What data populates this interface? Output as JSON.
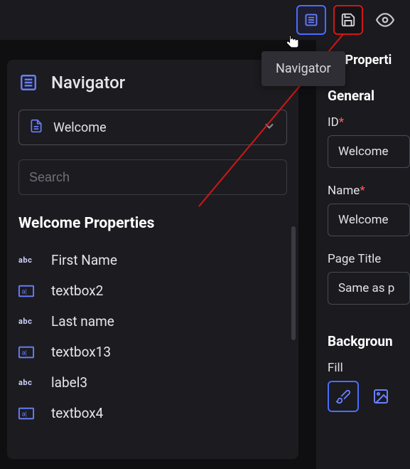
{
  "topbar": {
    "tooltip": "Navigator"
  },
  "navigator": {
    "title": "Navigator",
    "page_dropdown": "Welcome",
    "search_placeholder": "Search",
    "section_title": "Welcome Properties",
    "items": [
      {
        "kind": "abc",
        "label": "First Name"
      },
      {
        "kind": "tb",
        "label": "textbox2"
      },
      {
        "kind": "abc",
        "label": "Last name"
      },
      {
        "kind": "tb",
        "label": "textbox13"
      },
      {
        "kind": "abc",
        "label": "label3"
      },
      {
        "kind": "tb",
        "label": "textbox4"
      }
    ]
  },
  "right": {
    "tab": "ge Properti",
    "general": {
      "title": "General",
      "id_label": "ID",
      "id_value": "Welcome",
      "name_label": "Name",
      "name_value": "Welcome",
      "page_title_label": "Page Title",
      "page_title_value": "Same as p"
    },
    "background": {
      "title": "Backgroun",
      "fill_label": "Fill"
    }
  }
}
